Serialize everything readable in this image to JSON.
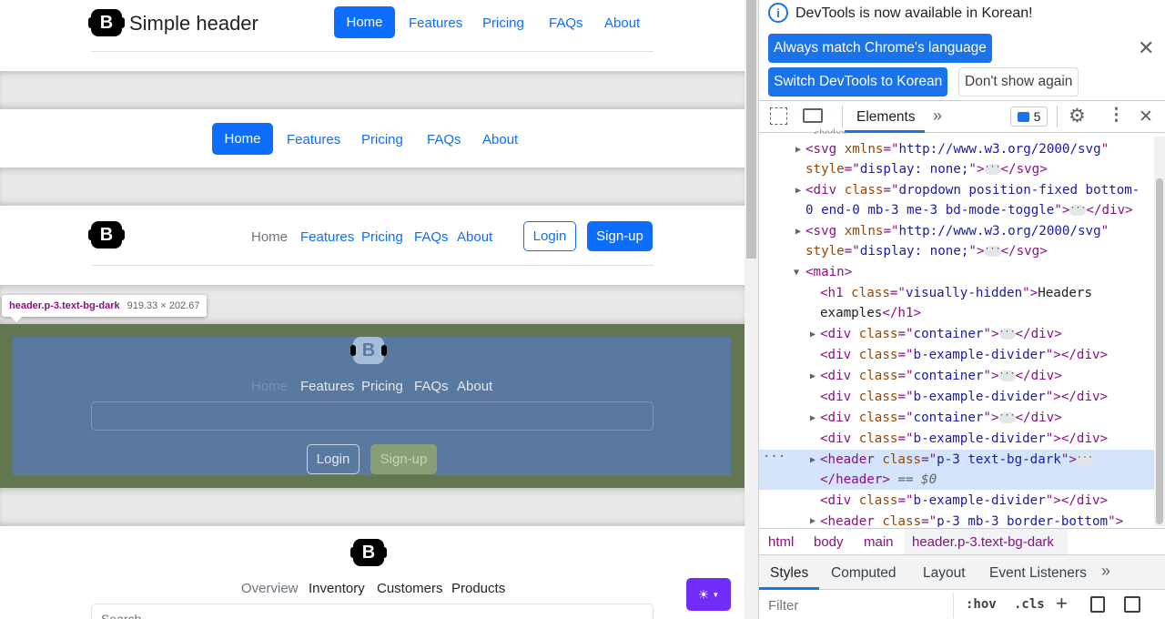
{
  "section1": {
    "brand": "Simple header",
    "nav": [
      "Home",
      "Features",
      "Pricing",
      "FAQs",
      "About"
    ]
  },
  "section2": {
    "nav": [
      "Home",
      "Features",
      "Pricing",
      "FAQs",
      "About"
    ]
  },
  "section3": {
    "nav": [
      "Home",
      "Features",
      "Pricing",
      "FAQs",
      "About"
    ],
    "login": "Login",
    "signup": "Sign-up"
  },
  "section4": {
    "tooltip_selector": "header.p-3.text-bg-dark",
    "tooltip_size": "919.33 × 202.67",
    "nav": [
      "Home",
      "Features",
      "Pricing",
      "FAQs",
      "About"
    ],
    "login": "Login",
    "signup": "Sign-up"
  },
  "section5": {
    "nav": [
      "Overview",
      "Inventory",
      "Customers",
      "Products"
    ],
    "search_placeholder": "Search..."
  },
  "theme_icon": "sun-icon",
  "devtools": {
    "banner_text": "DevTools is now available in Korean!",
    "btn_match": "Always match Chrome's language",
    "btn_switch": "Switch DevTools to Korean",
    "btn_dont": "Don't show again",
    "tab_elements": "Elements",
    "issues_count": "5",
    "breadcrumbs": [
      "html",
      "body",
      "main",
      "header.p-3.text-bg-dark"
    ],
    "lower_tabs": [
      "Styles",
      "Computed",
      "Layout",
      "Event Listeners"
    ],
    "filter_placeholder": "Filter",
    "hov": ":hov",
    "cls": ".cls",
    "dollar": "$0",
    "accent": "#1a73e8"
  }
}
